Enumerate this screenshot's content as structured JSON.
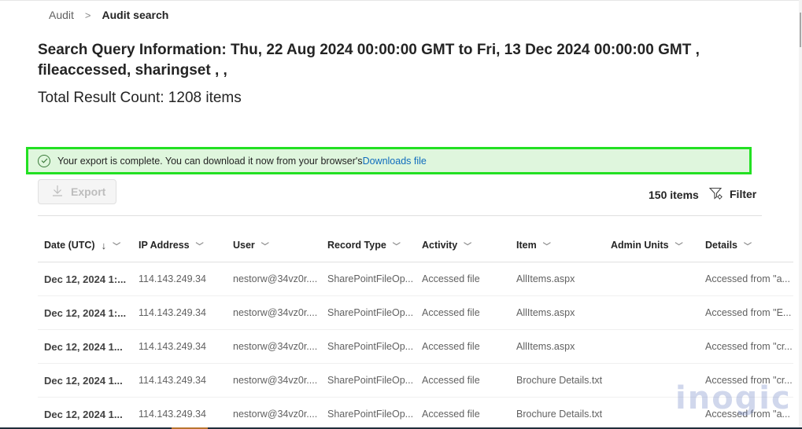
{
  "breadcrumb": {
    "parent": "Audit",
    "separator": ">",
    "current": "Audit search"
  },
  "query": {
    "title": "Search Query Information: Thu, 22 Aug 2024 00:00:00 GMT to Fri, 13 Dec 2024 00:00:00 GMT , fileaccessed, sharingset , ,",
    "total_count": "Total Result Count: 1208 items"
  },
  "banner": {
    "icon": "check-circle-icon",
    "message": "Your export is complete. You can download it now from your browser's",
    "link_text": "Downloads file",
    "accent_color": "#22e022",
    "background_color": "#dff6dd"
  },
  "toolbar": {
    "export_label": "Export",
    "export_icon": "download-icon",
    "items_count": "150 items",
    "filter_label": "Filter",
    "filter_icon": "filter-settings-icon"
  },
  "table": {
    "columns": [
      {
        "label": "Date (UTC)",
        "sorted": "descending"
      },
      {
        "label": "IP Address"
      },
      {
        "label": "User"
      },
      {
        "label": "Record Type"
      },
      {
        "label": "Activity"
      },
      {
        "label": "Item"
      },
      {
        "label": "Admin Units"
      },
      {
        "label": "Details"
      }
    ],
    "sort_arrow": "↓",
    "rows": [
      {
        "date": "Dec 12, 2024 1:...",
        "ip": "114.143.249.34",
        "user": "nestorw@34vz0r....",
        "record_type": "SharePointFileOp...",
        "activity": "Accessed file",
        "item": "AllItems.aspx",
        "admin_units": "",
        "details": "Accessed from \"a..."
      },
      {
        "date": "Dec 12, 2024 1:...",
        "ip": "114.143.249.34",
        "user": "nestorw@34vz0r....",
        "record_type": "SharePointFileOp...",
        "activity": "Accessed file",
        "item": "AllItems.aspx",
        "admin_units": "",
        "details": "Accessed from \"E..."
      },
      {
        "date": "Dec 12, 2024 1...",
        "ip": "114.143.249.34",
        "user": "nestorw@34vz0r....",
        "record_type": "SharePointFileOp...",
        "activity": "Accessed file",
        "item": "AllItems.aspx",
        "admin_units": "",
        "details": "Accessed from \"cr..."
      },
      {
        "date": "Dec 12, 2024 1...",
        "ip": "114.143.249.34",
        "user": "nestorw@34vz0r....",
        "record_type": "SharePointFileOp...",
        "activity": "Accessed file",
        "item": "Brochure Details.txt",
        "admin_units": "",
        "details": "Accessed from \"cr..."
      },
      {
        "date": "Dec 12, 2024 1...",
        "ip": "114.143.249.34",
        "user": "nestorw@34vz0r....",
        "record_type": "SharePointFileOp...",
        "activity": "Accessed file",
        "item": "Brochure Details.txt",
        "admin_units": "",
        "details": "Accessed from \"a..."
      }
    ]
  },
  "watermark": "inogic"
}
